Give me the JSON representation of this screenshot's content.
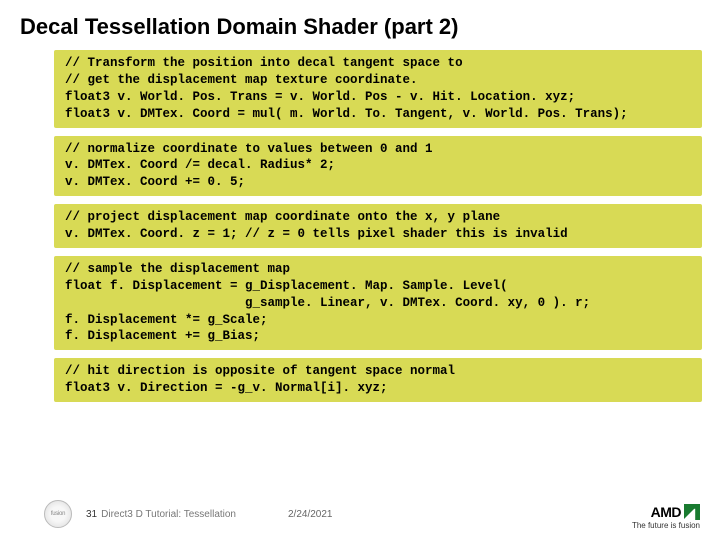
{
  "title": "Decal Tessellation Domain Shader (part 2)",
  "code_blocks": [
    "// Transform the position into decal tangent space to\n// get the displacement map texture coordinate.\nfloat3 v. World. Pos. Trans = v. World. Pos - v. Hit. Location. xyz;\nfloat3 v. DMTex. Coord = mul( m. World. To. Tangent, v. World. Pos. Trans);",
    "// normalize coordinate to values between 0 and 1\nv. DMTex. Coord /= decal. Radius* 2;\nv. DMTex. Coord += 0. 5;",
    "// project displacement map coordinate onto the x, y plane\nv. DMTex. Coord. z = 1; // z = 0 tells pixel shader this is invalid",
    "// sample the displacement map\nfloat f. Displacement = g_Displacement. Map. Sample. Level(\n                        g_sample. Linear, v. DMTex. Coord. xy, 0 ). r;\nf. Displacement *= g_Scale;\nf. Displacement += g_Bias;",
    "// hit direction is opposite of tangent space normal\nfloat3 v. Direction = -g_v. Normal[i]. xyz;"
  ],
  "footer": {
    "fusion_label": "fusion",
    "page_number": "31",
    "tutorial": "Direct3 D Tutorial: Tessellation",
    "date": "2/24/2021"
  },
  "logo": {
    "brand": "AMD",
    "tagline": "The future is fusion"
  }
}
